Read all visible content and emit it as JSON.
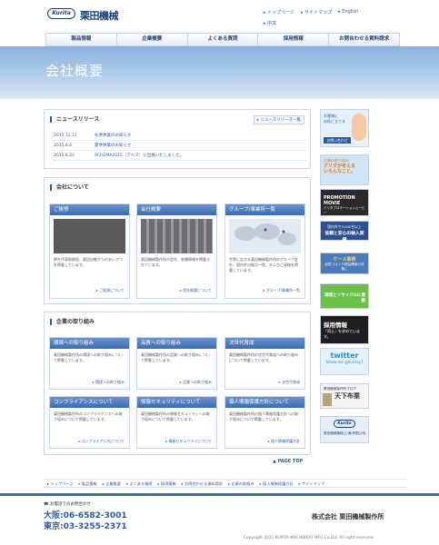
{
  "header": {
    "logo_text": "Kurita",
    "brand": "栗田機械",
    "top_links": [
      "トップページ",
      "サイトマップ",
      "English"
    ],
    "lang_cn": "中文"
  },
  "nav": [
    "製品情報",
    "企業概要",
    "よくある質問",
    "採用情報",
    "お問合わせる資料請求"
  ],
  "banner": {
    "title": "会社概要"
  },
  "news": {
    "heading": "ニュースリリース",
    "more": "ニュースリリース一覧",
    "items": [
      {
        "date": "2015.12.11",
        "title": "冬季休業のお知らせ"
      },
      {
        "date": "2015.8.4",
        "title": "夏季休業のお知らせ"
      },
      {
        "date": "2015.6.22",
        "title": "ACHEMA2015（アヘマ）に出展いたしました。"
      }
    ]
  },
  "about": {
    "heading": "会社について",
    "cards": [
      {
        "title": "ご挨拶",
        "text": "弊社代表取締役、栗田自敬からのあいさつを掲載しています。",
        "link": "ご挨拶について",
        "img": "#5a5a5a"
      },
      {
        "title": "会社概要",
        "text": "栗田機械製作所の会社、各種情報を掲載されています。",
        "link": "会社概要について",
        "img": "#7d7d80"
      },
      {
        "title": "グループ/事業所一覧",
        "text": "世界に広がる栗田機械製作所のグループ会社、国内外の拠点一覧、およびご連絡を掲載しています。",
        "link": "グループ/事業所一覧",
        "img": "#dde4ee"
      }
    ]
  },
  "initiatives": {
    "heading": "企業の取り組み",
    "cards": [
      {
        "title": "環境への取り組み",
        "text": "栗田機械製作所の環境への取り組みについて掲載しています。",
        "link": "環境への取り組み"
      },
      {
        "title": "品質への取り組み",
        "text": "栗田機械製作所の品質への取り組みについて掲載しています。",
        "link": "品質への取り組み"
      },
      {
        "title": "次世代育成",
        "text": "栗田機械製作所の次世代育成への取り組みについて掲載しています。",
        "link": "次世代育成"
      },
      {
        "title": "コンプライアンスについて",
        "text": "栗田機械製作所のコンプライアンスへの取り組みについて掲載しています。",
        "link": "コンプライアンスについて"
      },
      {
        "title": "情報セキュリティについて",
        "text": "栗田機械製作所の情報セキュリティへの取り組みについて掲載しています。",
        "link": "情報セキュリティについて"
      },
      {
        "title": "個人情報保護方針について",
        "text": "栗田機械製作所の個人情報保護方針への取り組みについて掲載しています。",
        "link": "個人情報保護方針"
      }
    ]
  },
  "page_top": "PAGE TOP",
  "sidebar": [
    {
      "name": "inquiry-banner",
      "lines": [
        "お客様に",
        "お役に立てる",
        "お問い合わせ"
      ],
      "bg": "#e6f0fa",
      "fg": "#2a5aa8"
    },
    {
      "name": "catalog-banner",
      "lines": [
        "企業の取り組み",
        "グリダが考える",
        "いろんなこと。"
      ],
      "bg": "#cfe4f5",
      "fg": "#e07a1f"
    },
    {
      "name": "promotion-movie-banner",
      "lines": [
        "PROMOTION MOVIE",
        "クリタプロモーションムービー"
      ],
      "bg": "#2a2a2a",
      "fg": "#ffffff"
    },
    {
      "name": "delivery-record-banner",
      "lines": [
        "国内外で3,000台以上",
        "信頼と安心の納入実績"
      ],
      "bg": "#2f4f8f",
      "fg": "#ffffff"
    },
    {
      "name": "case-study-banner",
      "lines": [
        "ケース事例",
        "品質コストや損益構造の改善に"
      ],
      "bg": "#4a7ab8",
      "fg": "#ffffff"
    },
    {
      "name": "recycle-banner",
      "lines": [
        "環境とリサイクルに貢献"
      ],
      "bg": "#6cbf4a",
      "fg": "#ffffff"
    },
    {
      "name": "recruit-banner",
      "lines": [
        "採用情報",
        "「同士」を求めています。"
      ],
      "bg": "#1f1f1f",
      "fg": "#ffffff"
    },
    {
      "name": "twitter-banner",
      "lines": [
        "twitter",
        "follow me @kuritay7"
      ],
      "bg": "#e6f2fb",
      "fg": "#2a8ad4"
    },
    {
      "name": "blog-banner",
      "lines": [
        "栗田機械製作所ブログ",
        "天下布栗"
      ],
      "bg": "#f4f4f4",
      "fg": "#333333"
    },
    {
      "name": "shanghai-banner",
      "lines": [
        "Kurita",
        "栗田機械機械(上海)有限公司"
      ],
      "bg": "#e6eef8",
      "fg": "#1c3f7a"
    }
  ],
  "footer": {
    "links": [
      "トップページ",
      "製品情報",
      "企業概要",
      "よくある質問",
      "採用情報",
      "お問合わせる資料請求",
      "企業の取組み",
      "個人情報保護方針",
      "サイトマップ"
    ],
    "contact_label": "お電話でのお問合わせ",
    "tel_osaka": "大阪:06-6582-3001",
    "tel_tokyo": "東京:03-3255-2371",
    "company": "株式会社 栗田機械製作所",
    "copyright": "Copyright 2011 KURITA MACHINERY MFG.Co.Ltd. All right reserved."
  }
}
